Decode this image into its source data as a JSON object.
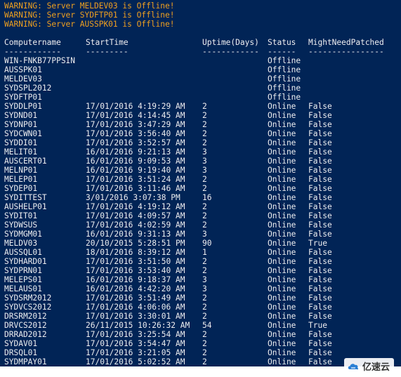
{
  "warnings": [
    "WARNING: Server MELDEV03 is Offline!",
    "WARNING: Server SYDFTP01 is Offline!",
    "WARNING: Server AUSSPK01 is Offline!"
  ],
  "table": {
    "headers": {
      "computername": "Computername",
      "starttime": "StartTime",
      "uptime": "Uptime(Days)",
      "status": "Status",
      "mightneedpatched": "MightNeedPatched"
    },
    "separators": {
      "computername": "------------",
      "starttime": "---------",
      "uptime": "------------",
      "status": "------",
      "mightneedpatched": "----------------"
    },
    "rows": [
      [
        "WIN-FNKB77PPSIN",
        "",
        "",
        "Offline",
        ""
      ],
      [
        "AUSSPK01",
        "",
        "",
        "Offline",
        ""
      ],
      [
        "MELDEV03",
        "",
        "",
        "Offline",
        ""
      ],
      [
        "SYDSPL2012",
        "",
        "",
        "Offline",
        ""
      ],
      [
        "SYDFTP01",
        "",
        "",
        "Offline",
        ""
      ],
      [
        "SYDDLP01",
        "17/01/2016 4:19:29 AM",
        "2",
        "Online",
        "False"
      ],
      [
        "SYDND01",
        "17/01/2016 4:14:45 AM",
        "2",
        "Online",
        "False"
      ],
      [
        "SYDNP01",
        "17/01/2016 3:47:29 AM",
        "2",
        "Online",
        "False"
      ],
      [
        "SYDCWN01",
        "17/01/2016 3:56:40 AM",
        "2",
        "Online",
        "False"
      ],
      [
        "SYDDI01",
        "17/01/2016 3:52:57 AM",
        "2",
        "Online",
        "False"
      ],
      [
        "MELIT01",
        "16/01/2016 9:21:13 AM",
        "3",
        "Online",
        "False"
      ],
      [
        "AUSCERT01",
        "16/01/2016 9:09:53 AM",
        "3",
        "Online",
        "False"
      ],
      [
        "MELNP01",
        "16/01/2016 9:19:40 AM",
        "3",
        "Online",
        "False"
      ],
      [
        "MELEP01",
        "17/01/2016 3:51:24 AM",
        "2",
        "Online",
        "False"
      ],
      [
        "SYDEP01",
        "17/01/2016 3:11:46 AM",
        "2",
        "Online",
        "False"
      ],
      [
        "SYDITTEST",
        "3/01/2016 3:07:38 PM",
        "16",
        "Online",
        "False"
      ],
      [
        "AUSHELP01",
        "17/01/2016 4:19:12 AM",
        "2",
        "Online",
        "False"
      ],
      [
        "SYDIT01",
        "17/01/2016 4:09:57 AM",
        "2",
        "Online",
        "False"
      ],
      [
        "SYDWSUS",
        "17/01/2016 4:02:59 AM",
        "2",
        "Online",
        "False"
      ],
      [
        "SYDMGM01",
        "16/01/2016 9:31:13 AM",
        "3",
        "Online",
        "False"
      ],
      [
        "MELDV03",
        "20/10/2015 5:28:51 PM",
        "90",
        "Online",
        "True"
      ],
      [
        "AUSSQL01",
        "18/01/2016 8:39:12 AM",
        "1",
        "Online",
        "False"
      ],
      [
        "SYDHARD01",
        "17/01/2016 3:51:50 AM",
        "2",
        "Online",
        "False"
      ],
      [
        "SYDPRN01",
        "17/01/2016 3:53:40 AM",
        "2",
        "Online",
        "False"
      ],
      [
        "MELEPS01",
        "16/01/2016 9:18:37 AM",
        "3",
        "Online",
        "False"
      ],
      [
        "MELAUS01",
        "16/01/2016 4:42:20 AM",
        "3",
        "Online",
        "False"
      ],
      [
        "SYDSRM2012",
        "17/01/2016 3:51:49 AM",
        "2",
        "Online",
        "False"
      ],
      [
        "SYDVCS2012",
        "17/01/2016 4:06:06 AM",
        "2",
        "Online",
        "False"
      ],
      [
        "DRSRM2012",
        "17/01/2016 3:30:01 AM",
        "2",
        "Online",
        "False"
      ],
      [
        "DRVCS2012",
        "26/11/2015 10:26:32 AM",
        "54",
        "Online",
        "True"
      ],
      [
        "DRRAD2012",
        "17/01/2016 3:25:54 AM",
        "2",
        "Online",
        "False"
      ],
      [
        "SYDAV01",
        "17/01/2016 3:54:47 AM",
        "2",
        "Online",
        "False"
      ],
      [
        "DRSQL01",
        "17/01/2016 3:21:05 AM",
        "2",
        "Online",
        "False"
      ],
      [
        "SYDMPAY01",
        "17/01/2016 5:02:52 AM",
        "2",
        "Online",
        "False"
      ]
    ]
  },
  "watermark": {
    "text": "亿速云",
    "icon": "cloud-logo-icon"
  },
  "colors": {
    "background": "#012456",
    "text": "#eeedf0",
    "warning": "#f0a020"
  }
}
